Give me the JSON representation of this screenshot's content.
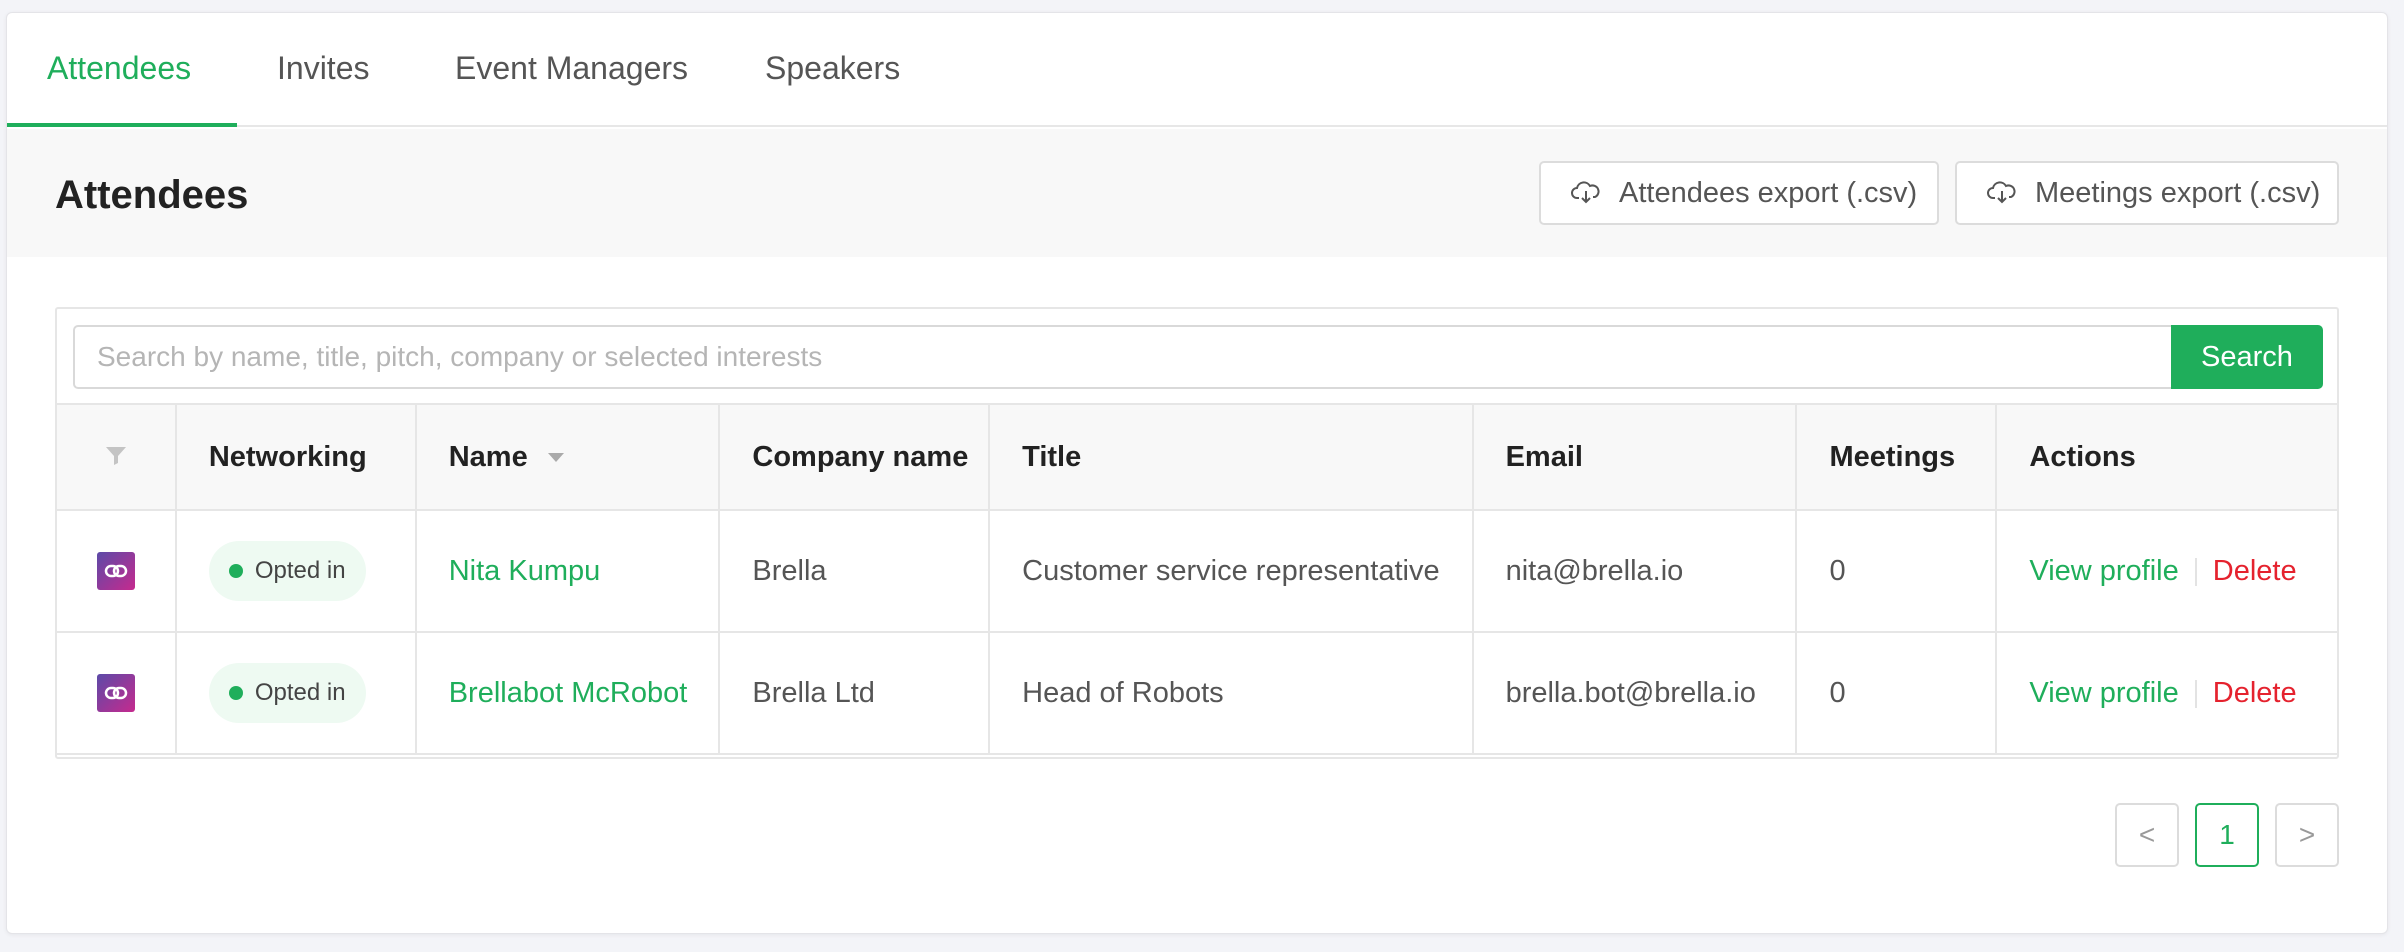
{
  "tabs": [
    {
      "label": "Attendees",
      "active": true
    },
    {
      "label": "Invites"
    },
    {
      "label": "Event Managers"
    },
    {
      "label": "Speakers"
    }
  ],
  "header": {
    "title": "Attendees",
    "attendees_export_label": "Attendees export (.csv)",
    "meetings_export_label": "Meetings export (.csv)"
  },
  "search": {
    "placeholder": "Search by name, title, pitch, company or selected interests",
    "value": "",
    "button_label": "Search"
  },
  "table": {
    "columns": [
      "Networking",
      "Name",
      "Company name",
      "Title",
      "Email",
      "Meetings",
      "Actions"
    ],
    "rows": [
      {
        "networking": "Opted in",
        "name": "Nita Kumpu",
        "company": "Brella",
        "title": "Customer service representative",
        "email": "nita@brella.io",
        "meetings": "0",
        "view_label": "View profile",
        "delete_label": "Delete"
      },
      {
        "networking": "Opted in",
        "name": "Brellabot McRobot",
        "company": "Brella Ltd",
        "title": "Head of Robots",
        "email": "brella.bot@brella.io",
        "meetings": "0",
        "view_label": "View profile",
        "delete_label": "Delete"
      }
    ]
  },
  "pagination": {
    "prev_symbol": "<",
    "current_page": "1",
    "next_symbol": ">"
  },
  "icons": [
    "cloud-download-icon",
    "filter-icon",
    "link-icon",
    "sort-caret-icon"
  ],
  "colors": {
    "accent": "#1fae5b",
    "danger": "#e5222e",
    "badge_bg": "#eefaf2"
  }
}
